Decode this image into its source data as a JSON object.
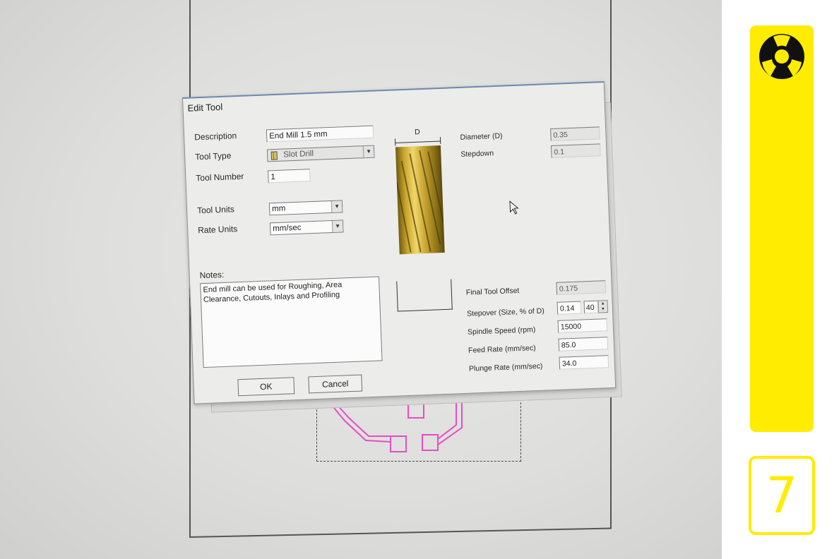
{
  "dialog": {
    "title": "Edit Tool",
    "description_label": "Description",
    "description_value": "End Mill 1.5 mm",
    "tool_type_label": "Tool Type",
    "tool_type_value": "Slot Drill",
    "tool_number_label": "Tool Number",
    "tool_number_value": "1",
    "tool_units_label": "Tool Units",
    "tool_units_value": "mm",
    "rate_units_label": "Rate Units",
    "rate_units_value": "mm/sec",
    "notes_label": "Notes:",
    "notes_value": "End mill can be used for Roughing, Area\nClearance, Cutouts, Inlays and Profiling",
    "diagram_label": "D",
    "diameter_label": "Diameter (D)",
    "diameter_value": "0.35",
    "stepdown_label": "Stepdown",
    "stepdown_value": "0.1",
    "final_offset_label": "Final Tool Offset",
    "final_offset_value": "0.175",
    "stepover_label": "Stepover (Size, % of D)",
    "stepover_size_value": "0.14",
    "stepover_percent_value": "40",
    "spindle_label": "Spindle Speed (rpm)",
    "spindle_value": "15000",
    "feed_label": "Feed Rate (mm/sec)",
    "feed_value": "85.0",
    "plunge_label": "Plunge Rate (mm/sec)",
    "plunge_value": "34.0",
    "ok_label": "OK",
    "cancel_label": "Cancel"
  },
  "sidebar": {
    "step_number": "7",
    "accent_color": "#ffec00"
  },
  "icons": {
    "brand_logo": "fab-logo-icon",
    "tool_type": "slot-drill-icon",
    "cursor": "mouse-cursor-icon"
  }
}
